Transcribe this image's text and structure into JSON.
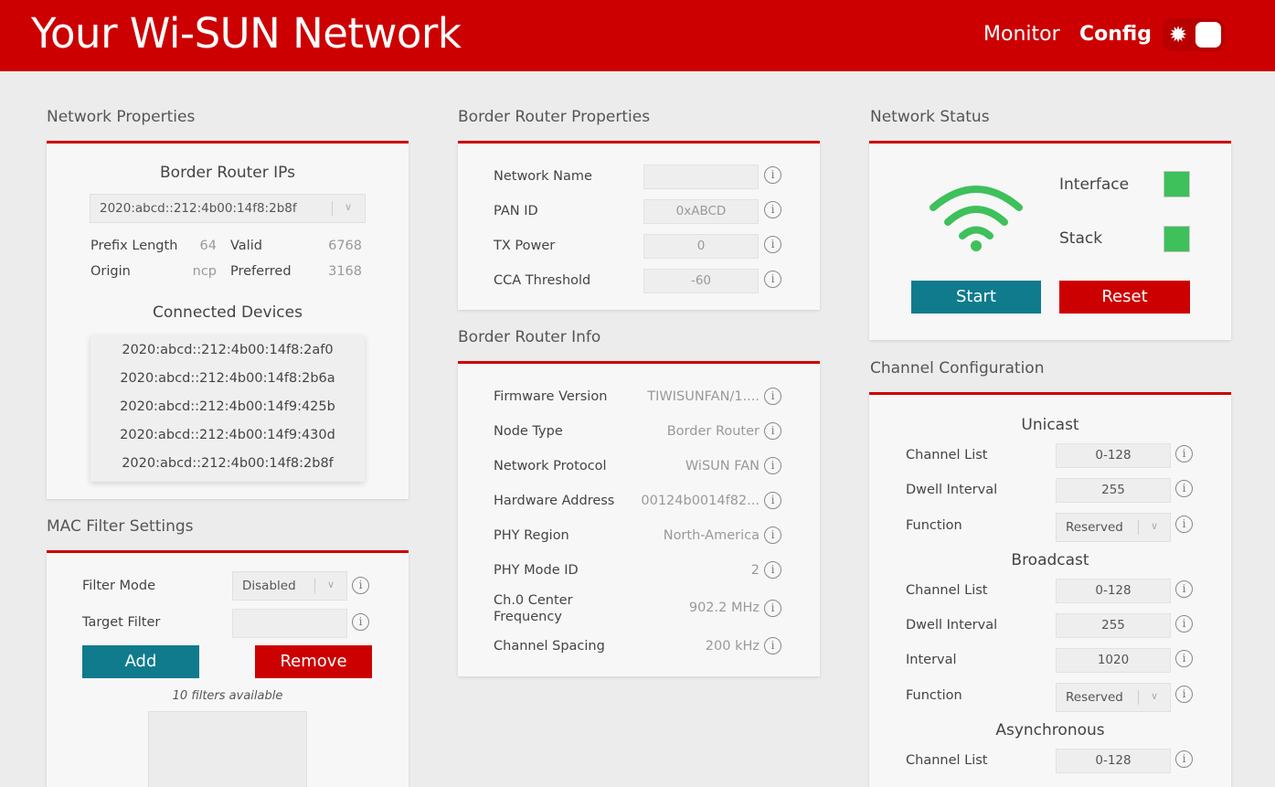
{
  "header": {
    "title": "Your Wi-SUN Network",
    "nav": {
      "monitor": "Monitor",
      "config": "Config"
    },
    "theme_icon": "sun-icon"
  },
  "network_properties": {
    "title": "Network Properties",
    "br_ips_heading": "Border Router IPs",
    "selected_ip": "2020:abcd::212:4b00:14f8:2b8f",
    "prefix_length_label": "Prefix Length",
    "prefix_length_value": "64",
    "valid_label": "Valid",
    "valid_value": "6768",
    "origin_label": "Origin",
    "origin_value": "ncp",
    "preferred_label": "Preferred",
    "preferred_value": "3168",
    "connected_heading": "Connected Devices",
    "devices": [
      "2020:abcd::212:4b00:14f8:2af0",
      "2020:abcd::212:4b00:14f8:2b6a",
      "2020:abcd::212:4b00:14f9:425b",
      "2020:abcd::212:4b00:14f9:430d",
      "2020:abcd::212:4b00:14f8:2b8f"
    ]
  },
  "mac_filter": {
    "title": "MAC Filter Settings",
    "filter_mode_label": "Filter Mode",
    "filter_mode_value": "Disabled",
    "target_filter_label": "Target Filter",
    "target_filter_value": "",
    "add_label": "Add",
    "remove_label": "Remove",
    "filters_note": "10 filters available"
  },
  "br_properties": {
    "title": "Border Router Properties",
    "network_name_label": "Network Name",
    "network_name_value": "",
    "pan_id_label": "PAN ID",
    "pan_id_value": "0xABCD",
    "tx_power_label": "TX Power",
    "tx_power_value": "0",
    "cca_label": "CCA Threshold",
    "cca_value": "-60"
  },
  "br_info": {
    "title": "Border Router Info",
    "rows": [
      {
        "label": "Firmware Version",
        "value": "TIWISUNFAN/1...."
      },
      {
        "label": "Node Type",
        "value": "Border Router"
      },
      {
        "label": "Network Protocol",
        "value": "WiSUN FAN"
      },
      {
        "label": "Hardware Address",
        "value": "00124b0014f82..."
      },
      {
        "label": "PHY Region",
        "value": "North-America"
      },
      {
        "label": "PHY Mode ID",
        "value": "2"
      },
      {
        "label": "Ch.0 Center Frequency",
        "value": "902.2 MHz"
      },
      {
        "label": "Channel Spacing",
        "value": "200 kHz"
      }
    ]
  },
  "network_status": {
    "title": "Network Status",
    "interface_label": "Interface",
    "stack_label": "Stack",
    "interface_color": "#3ec05a",
    "stack_color": "#3ec05a",
    "wifi_color": "#3ec05a",
    "start_label": "Start",
    "reset_label": "Reset"
  },
  "channel_config": {
    "title": "Channel Configuration",
    "unicast_heading": "Unicast",
    "uc_channel_list_label": "Channel List",
    "uc_channel_list_value": "0-128",
    "uc_dwell_label": "Dwell Interval",
    "uc_dwell_value": "255",
    "uc_function_label": "Function",
    "uc_function_value": "Reserved",
    "broadcast_heading": "Broadcast",
    "bc_channel_list_label": "Channel List",
    "bc_channel_list_value": "0-128",
    "bc_dwell_label": "Dwell Interval",
    "bc_dwell_value": "255",
    "bc_interval_label": "Interval",
    "bc_interval_value": "1020",
    "bc_function_label": "Function",
    "bc_function_value": "Reserved",
    "async_heading": "Asynchronous",
    "async_channel_list_label": "Channel List",
    "async_channel_list_value": "0-128"
  },
  "colors": {
    "brand": "#cc0000",
    "teal": "#0f7b8d",
    "status_ok": "#3ec05a"
  },
  "icons": {
    "info": "i"
  }
}
